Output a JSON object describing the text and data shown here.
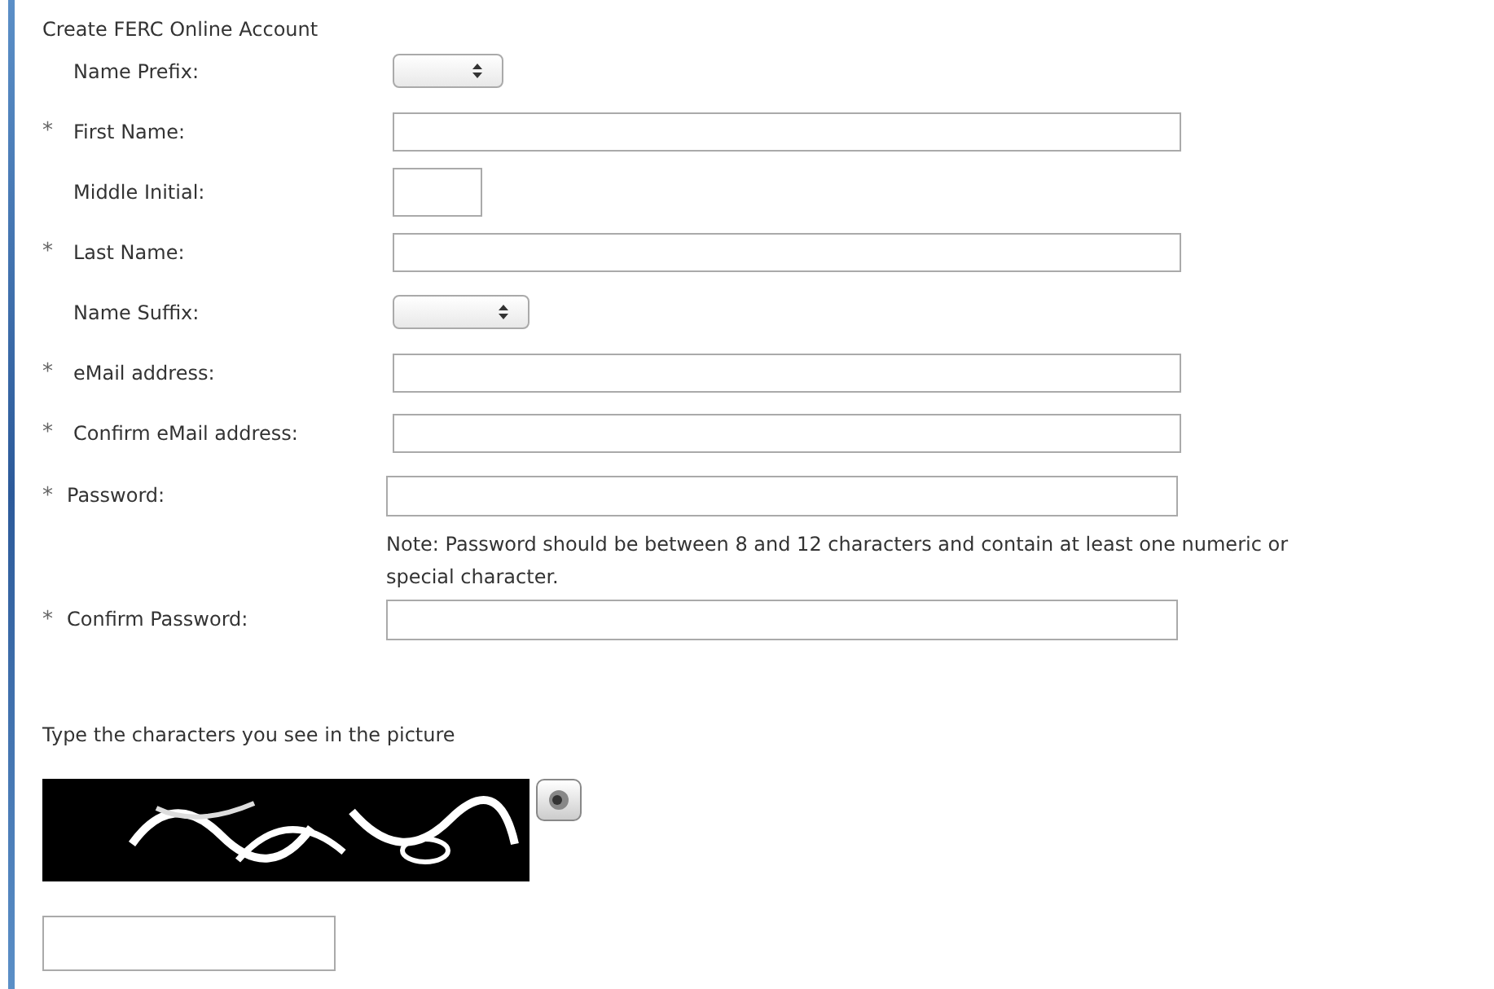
{
  "title": "Create FERC Online Account",
  "fields": [
    {
      "label": "Name Prefix:",
      "kind": "select"
    },
    {
      "mark": "*",
      "label": "First Name:",
      "kind": "text"
    },
    {
      "label": "Middle Initial:",
      "kind": "initial"
    },
    {
      "mark": "*",
      "label": "Last Name:",
      "kind": "text"
    },
    {
      "label": "Name Suffix:",
      "kind": "select-wide"
    },
    {
      "mark": "*",
      "label": "eMail address:",
      "kind": "text"
    },
    {
      "mark": "*",
      "label": "Confirm eMail address:",
      "kind": "text"
    }
  ],
  "password_fields": [
    {
      "mark": "*",
      "label": "Password:",
      "note": "Note: Password should be between 8 and 12 characters and contain at least one numeric or special character."
    },
    {
      "mark": "*",
      "label": "Confirm Password:"
    }
  ],
  "captcha": {
    "prompt": "Type the characters you see in the picture"
  }
}
